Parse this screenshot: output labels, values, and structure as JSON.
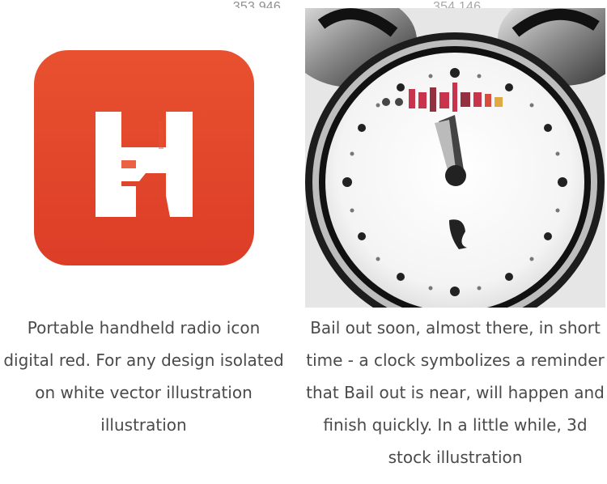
{
  "results": [
    {
      "count": "353,946",
      "icon": "radio-app-icon",
      "caption": "Portable handheld radio icon digital red. For any design isolated on white vector illustration illustration"
    },
    {
      "count": "354,146",
      "icon": "alarm-clock-illustration",
      "caption": "Bail out soon, almost there, in short time - a clock symbolizes a reminder that Bail out is near, will happen and finish quickly. In a little while, 3d stock illustration"
    }
  ],
  "colors": {
    "icon_red": "#e1452b",
    "caption_text": "#4a4a4a",
    "count_text": "#8f8f8f"
  }
}
